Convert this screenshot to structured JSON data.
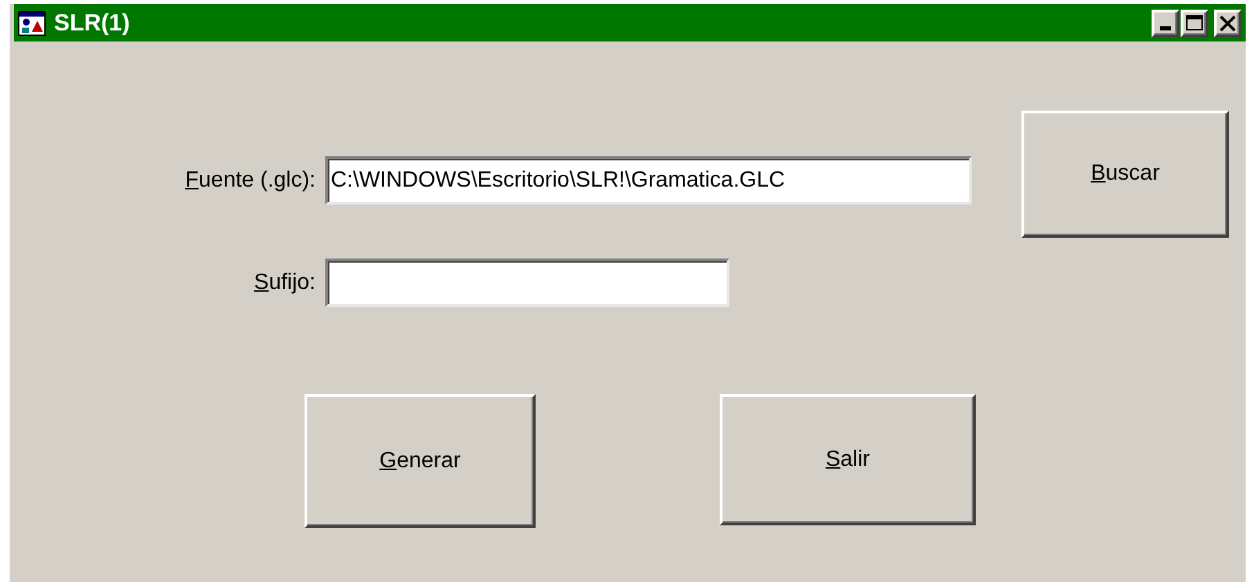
{
  "window": {
    "title": "SLR(1)"
  },
  "fields": [
    {
      "label": "Fuente (.glc):",
      "value": "C:\\WINDOWS\\Escritorio\\SLR!\\Gramatica.GLC"
    },
    {
      "label": "Sufijo:"
    }
  ],
  "side_button": "Buscar",
  "buttons": [
    "Generar",
    "Salir"
  ]
}
